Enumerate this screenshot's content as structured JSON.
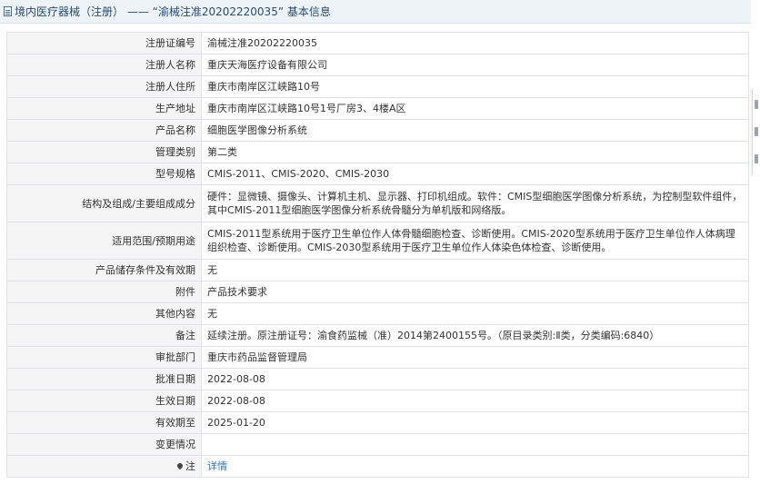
{
  "header": {
    "title": "境内医疗器械（注册） —— “渝械注准20202220035” 基本信息"
  },
  "rows": [
    {
      "label": "注册证编号",
      "value": "渝械注准20202220035"
    },
    {
      "label": "注册人名称",
      "value": "重庆天海医疗设备有限公司"
    },
    {
      "label": "注册人住所",
      "value": "重庆市南岸区江峡路10号"
    },
    {
      "label": "生产地址",
      "value": "重庆市南岸区江峡路10号1号厂房3、4楼A区"
    },
    {
      "label": "产品名称",
      "value": "细胞医学图像分析系统"
    },
    {
      "label": "管理类别",
      "value": "第二类"
    },
    {
      "label": "型号规格",
      "value": "CMIS-2011、CMIS-2020、CMIS-2030"
    },
    {
      "label": "结构及组成/主要组成成分",
      "value": "硬件：显微镜、摄像头、计算机主机、显示器、打印机组成。软件：CMIS型细胞医学图像分析系统，为控制型软件组件，其中CMIS-2011型细胞医学图像分析系统骨髓分为单机版和网络版。"
    },
    {
      "label": "适用范围/预期用途",
      "value": "CMIS-2011型系统用于医疗卫生单位作人体骨髓细胞检查、诊断使用。CMIS-2020型系统用于医疗卫生单位作人体病理组织检查、诊断使用。CMIS-2030型系统用于医疗卫生单位作人体染色体检查、诊断使用。"
    },
    {
      "label": "产品储存条件及有效期",
      "value": "无"
    },
    {
      "label": "附件",
      "value": "产品技术要求"
    },
    {
      "label": "其他内容",
      "value": "无"
    },
    {
      "label": "备注",
      "value": "延续注册。原注册证号：渝食药监械（准）2014第2400155号。（原目录类别:Ⅱ类，分类编码:6840）"
    },
    {
      "label": "审批部门",
      "value": "重庆市药品监督管理局"
    },
    {
      "label": "批准日期",
      "value": "2022-08-08"
    },
    {
      "label": "生效日期",
      "value": "2022-08-08"
    },
    {
      "label": "有效期至",
      "value": "2025-01-20"
    },
    {
      "label": "变更情况",
      "value": ""
    }
  ],
  "note_row": {
    "label": "注",
    "link": "详情",
    "icon": "pin-icon"
  }
}
